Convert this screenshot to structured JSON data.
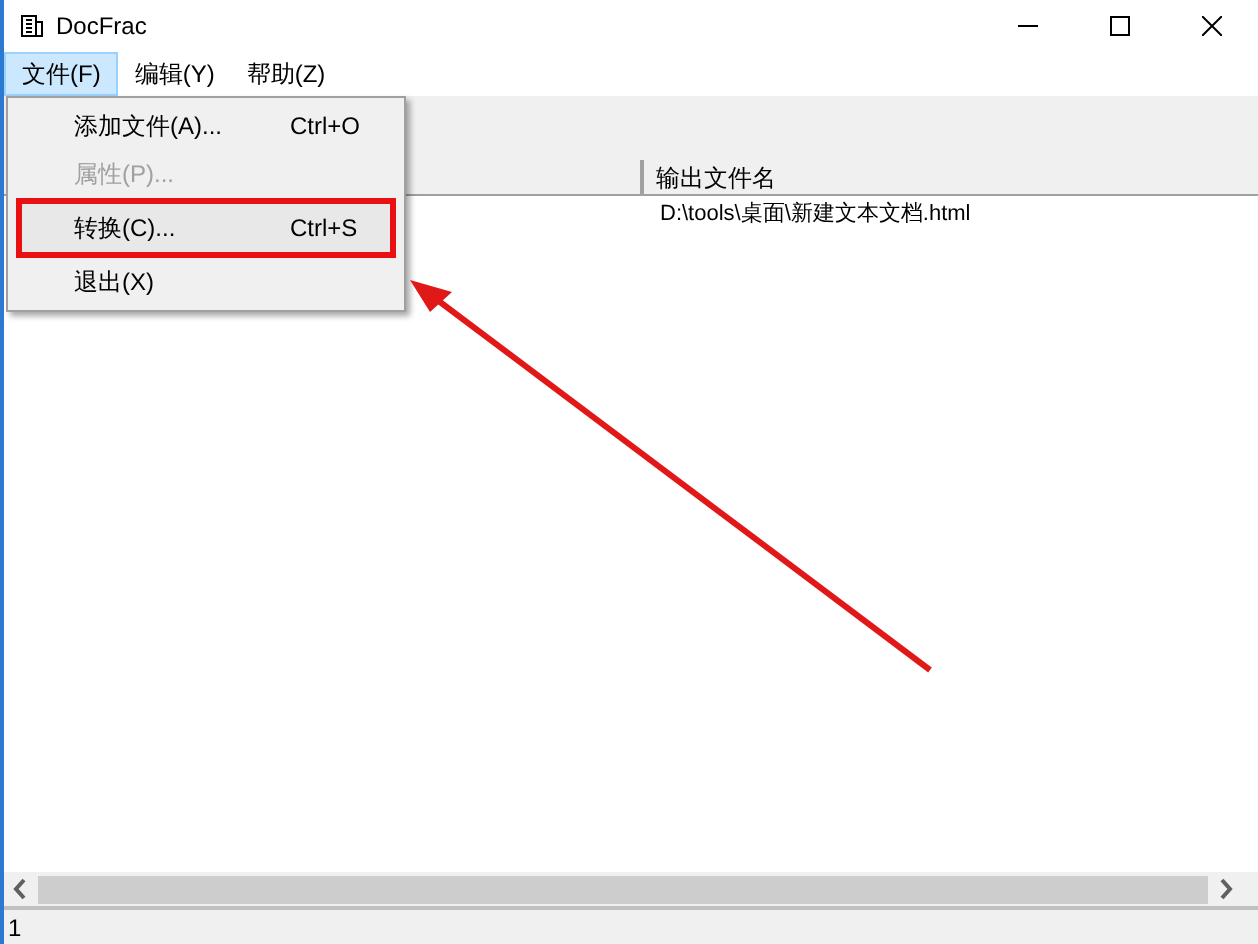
{
  "window": {
    "title": "DocFrac"
  },
  "menu_bar": [
    {
      "label": "文件(F)",
      "selected": true
    },
    {
      "label": "编辑(Y)",
      "selected": false
    },
    {
      "label": "帮助(Z)",
      "selected": false
    }
  ],
  "dropdown": [
    {
      "label": "添加文件(A)...",
      "shortcut": "Ctrl+O",
      "disabled": false,
      "annotated": false
    },
    {
      "label": "属性(P)...",
      "disabled": true,
      "annotated": false
    },
    {
      "label": "转换(C)...",
      "shortcut": "Ctrl+S",
      "disabled": false,
      "annotated": true
    },
    {
      "label": "退出(X)",
      "disabled": false,
      "annotated": false
    }
  ],
  "table": {
    "columns": [
      "输出文件名"
    ],
    "rows": [
      [
        "D:\\tools\\桌面\\新建文本文档.html"
      ]
    ]
  },
  "status_bar": "1"
}
